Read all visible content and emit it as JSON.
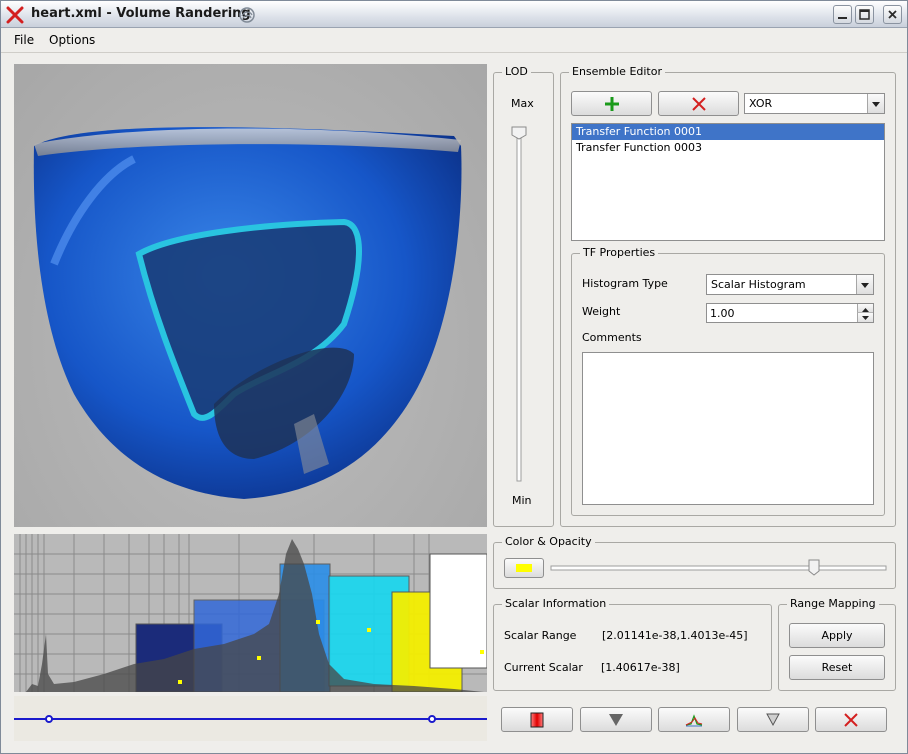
{
  "window": {
    "title": "heart.xml - Volume Randering"
  },
  "menu": {
    "file": "File",
    "options": "Options"
  },
  "lod": {
    "title": "LOD",
    "max_label": "Max",
    "min_label": "Min",
    "level": 1.0
  },
  "ensemble": {
    "title": "Ensemble Editor",
    "operation": "XOR",
    "items": [
      "Transfer Function 0001",
      "Transfer Function 0003"
    ],
    "selected_index": 0
  },
  "tf_properties": {
    "title": "TF Properties",
    "histogram_type_label": "Histogram Type",
    "histogram_type_value": "Scalar Histogram",
    "weight_label": "Weight",
    "weight_value": "1.00",
    "comments_label": "Comments",
    "comments_value": ""
  },
  "color_opacity": {
    "title": "Color & Opacity",
    "swatch_color": "#ffff00",
    "opacity": 0.79
  },
  "scalar_info": {
    "title": "Scalar Information",
    "range_label": "Scalar Range",
    "range_value": "[2.01141e-38,1.4013e-45]",
    "current_label": "Current Scalar",
    "current_value": "[1.40617e-38]"
  },
  "range_mapping": {
    "title": "Range Mapping",
    "apply": "Apply",
    "reset": "Reset"
  },
  "icons": {
    "add": "plus-icon",
    "delete": "x-icon",
    "colormap": "colormap-icon",
    "down": "triangle-down-icon",
    "curve": "curve-icon",
    "down_outline": "triangle-down-outline-icon",
    "close": "x-icon"
  },
  "colors": {
    "accent_blue": "#3f74c8",
    "add_green": "#1a9a1a",
    "delete_red": "#d42020",
    "slider_line": "#1a1acc"
  }
}
